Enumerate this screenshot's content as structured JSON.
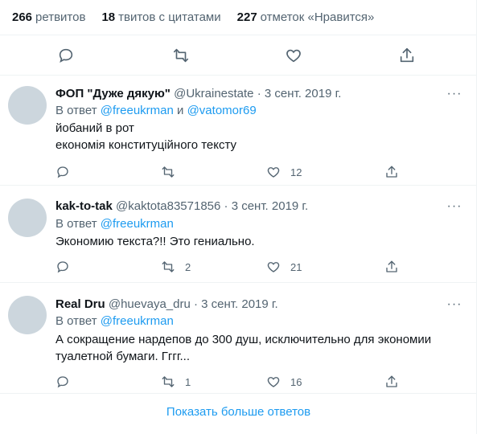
{
  "stats": {
    "retweets_count": "266",
    "retweets_label": "ретвитов",
    "quotes_count": "18",
    "quotes_label": "твитов с цитатами",
    "likes_count": "227",
    "likes_label": "отметок «Нравится»"
  },
  "main_actions": [
    "reply-icon",
    "retweet-icon",
    "like-icon",
    "share-icon"
  ],
  "replies": [
    {
      "name": "ФОП \"Дуже дякую\"",
      "handle": "@Ukrainestate",
      "dot": "·",
      "date": "3 сент. 2019 г.",
      "in_reply_prefix": "В ответ",
      "mention1": "@freeukrman",
      "joiner": "и",
      "mention2": "@vatomor69",
      "text_line1": "йобаний в рот",
      "text_line2": "економія конституційного тексту",
      "retweets": "",
      "likes": "12"
    },
    {
      "name": "kak-to-tak",
      "handle": "@kaktota83571856",
      "dot": "·",
      "date": "3 сент. 2019 г.",
      "in_reply_prefix": "В ответ",
      "mention1": "@freeukrman",
      "text_line1": "Экономию текста?!! Это гениально.",
      "retweets": "2",
      "likes": "21"
    },
    {
      "name": "Real Dru",
      "handle": "@huevaya_dru",
      "dot": "·",
      "date": "3 сент. 2019 г.",
      "in_reply_prefix": "В ответ",
      "mention1": "@freeukrman",
      "text_line1": "А сокращение нардепов до 300 душ, исключительно для экономии",
      "text_line2": "туалетной бумаги. Гггг...",
      "retweets": "1",
      "likes": "16"
    }
  ],
  "more_label": "···",
  "show_more": "Показать больше ответов",
  "colors": {
    "accent": "#1d9bf0",
    "secondary": "#536471",
    "border": "#eff3f4",
    "avatar": "#ccd6dd"
  }
}
